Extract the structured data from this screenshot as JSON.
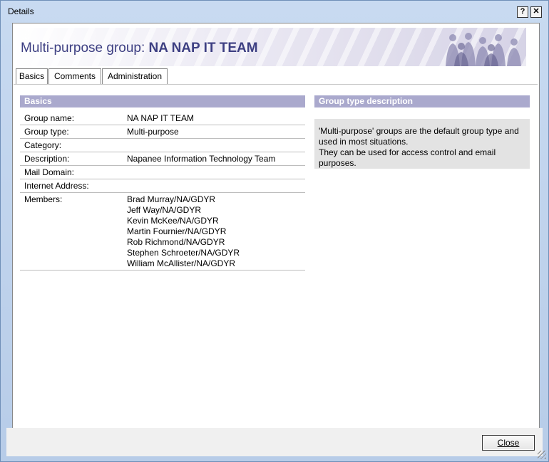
{
  "window": {
    "title": "Details",
    "help_btn": "?",
    "close_btn": "✕"
  },
  "banner": {
    "prefix": "Multi-purpose group: ",
    "group": "NA NAP IT TEAM"
  },
  "tabs": [
    {
      "label": "Basics"
    },
    {
      "label": "Comments"
    },
    {
      "label": "Administration"
    }
  ],
  "basics": {
    "heading": "Basics",
    "fields": [
      {
        "label": "Group name:",
        "value": "NA NAP IT TEAM"
      },
      {
        "label": "Group type:",
        "value": "Multi-purpose"
      },
      {
        "label": "Category:",
        "value": ""
      },
      {
        "label": "Description:",
        "value": "Napanee Information Technology Team"
      },
      {
        "label": "Mail Domain:",
        "value": ""
      },
      {
        "label": "Internet Address:",
        "value": ""
      }
    ],
    "members_label": "Members:",
    "members": [
      "Brad Murray/NA/GDYR",
      "Jeff Way/NA/GDYR",
      "Kevin McKee/NA/GDYR",
      "Martin Fournier/NA/GDYR",
      "Rob Richmond/NA/GDYR",
      "Stephen Schroeter/NA/GDYR",
      "William McAllister/NA/GDYR"
    ]
  },
  "group_type": {
    "heading": "Group type description",
    "line1": "'Multi-purpose' groups are the default group type and",
    "line2": "used in most situations.",
    "line3": "They can be used for access control and email",
    "line4": "purposes."
  },
  "footer": {
    "close_label": "Close"
  },
  "colors": {
    "section_header": "#aaa9cd",
    "banner_text": "#3d3f82",
    "desc_bg": "#e3e3e3"
  }
}
